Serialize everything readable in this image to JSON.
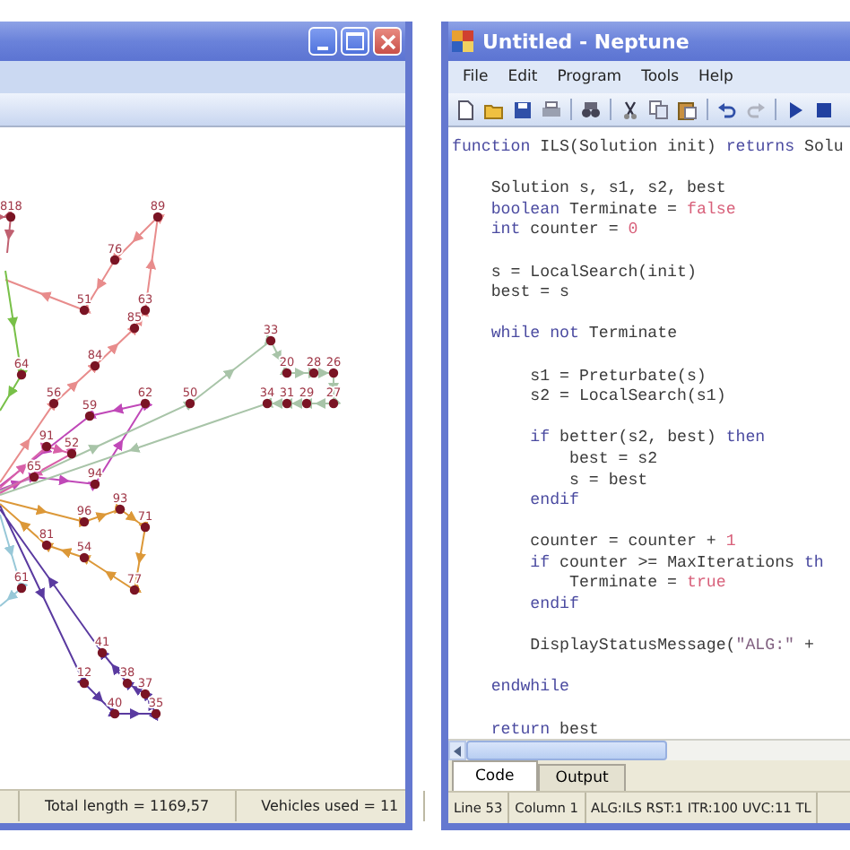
{
  "graph_window": {
    "routes": [
      {
        "color": "#e88c8c",
        "stops": [
          {
            "label": "56"
          },
          {
            "label": "84"
          },
          {
            "label": "85"
          },
          {
            "label": "63"
          },
          {
            "label": "89"
          },
          {
            "label": "76"
          },
          {
            "label": "51"
          }
        ]
      },
      {
        "color": "#78c048",
        "stops": [
          {
            "label": "64"
          }
        ]
      },
      {
        "color": "#c048b8",
        "stops": [
          {
            "label": "65"
          },
          {
            "label": "94"
          },
          {
            "label": "62"
          },
          {
            "label": "59"
          }
        ]
      },
      {
        "color": "#a8c4a8",
        "stops": [
          {
            "label": "50"
          },
          {
            "label": "33"
          },
          {
            "label": "20"
          },
          {
            "label": "28"
          },
          {
            "label": "26"
          }
        ]
      },
      {
        "color": "#dc9838",
        "stops": [
          {
            "label": "96"
          },
          {
            "label": "93"
          },
          {
            "label": "71"
          },
          {
            "label": "77"
          },
          {
            "label": "54"
          },
          {
            "label": "81"
          }
        ]
      },
      {
        "color": "#5a3aa0",
        "stops": [
          {
            "label": "12"
          },
          {
            "label": "40"
          },
          {
            "label": "35"
          },
          {
            "label": "37"
          },
          {
            "label": "38"
          },
          {
            "label": "41"
          }
        ]
      },
      {
        "color": "#98c8d8",
        "stops": [
          {
            "label": "61"
          }
        ]
      },
      {
        "color": "#d860a8",
        "stops": [
          {
            "label": "91"
          },
          {
            "label": "52"
          }
        ]
      },
      {
        "color": "#c06070",
        "stops": [
          {
            "label": "818"
          }
        ]
      },
      {
        "color": "#a8c4a8",
        "reversed": true,
        "stops": [
          {
            "label": "34"
          },
          {
            "label": "31"
          },
          {
            "label": "29"
          },
          {
            "label": "27"
          }
        ]
      }
    ],
    "status_bar": [
      "Total length = 1169,57",
      "Vehicles used = 11"
    ]
  },
  "editor_window": {
    "title": "Untitled - Neptune",
    "menu": [
      "File",
      "Edit",
      "Program",
      "Tools",
      "Help"
    ],
    "code_lines": [
      {
        "kind": "code",
        "tokens": [
          {
            "kind": "kw",
            "text": "function"
          },
          {
            "kind": "text",
            "text": " ILS(Solution init) "
          },
          {
            "kind": "kw",
            "text": "returns"
          },
          {
            "kind": "text",
            "text": " Solu"
          }
        ]
      },
      {
        "kind": "blank"
      },
      {
        "kind": "code",
        "tokens": [
          {
            "kind": "text",
            "text": "    Solution s, s1, s2, best"
          }
        ]
      },
      {
        "kind": "code",
        "tokens": [
          {
            "kind": "kw",
            "text": "    boolean"
          },
          {
            "kind": "text",
            "text": " Terminate = "
          },
          {
            "kind": "lit",
            "text": "false"
          }
        ]
      },
      {
        "kind": "code",
        "tokens": [
          {
            "kind": "kw",
            "text": "    int"
          },
          {
            "kind": "text",
            "text": " counter = "
          },
          {
            "kind": "lit",
            "text": "0"
          }
        ]
      },
      {
        "kind": "blank"
      },
      {
        "kind": "code",
        "tokens": [
          {
            "kind": "text",
            "text": "    s = LocalSearch(init)"
          }
        ]
      },
      {
        "kind": "code",
        "tokens": [
          {
            "kind": "text",
            "text": "    best = s"
          }
        ]
      },
      {
        "kind": "blank"
      },
      {
        "kind": "code",
        "tokens": [
          {
            "kind": "kw",
            "text": "    while not"
          },
          {
            "kind": "text",
            "text": " Terminate"
          }
        ]
      },
      {
        "kind": "blank"
      },
      {
        "kind": "code",
        "tokens": [
          {
            "kind": "text",
            "text": "        s1 = Preturbate(s)"
          }
        ]
      },
      {
        "kind": "code",
        "tokens": [
          {
            "kind": "text",
            "text": "        s2 = LocalSearch(s1)"
          }
        ]
      },
      {
        "kind": "blank"
      },
      {
        "kind": "code",
        "tokens": [
          {
            "kind": "kw",
            "text": "        if"
          },
          {
            "kind": "text",
            "text": " better(s2, best) "
          },
          {
            "kind": "kw",
            "text": "then"
          }
        ]
      },
      {
        "kind": "code",
        "tokens": [
          {
            "kind": "text",
            "text": "            best = s2"
          }
        ]
      },
      {
        "kind": "code",
        "tokens": [
          {
            "kind": "text",
            "text": "            s = best"
          }
        ]
      },
      {
        "kind": "code",
        "tokens": [
          {
            "kind": "kw",
            "text": "        endif"
          }
        ]
      },
      {
        "kind": "blank"
      },
      {
        "kind": "code",
        "tokens": [
          {
            "kind": "text",
            "text": "        counter = counter + "
          },
          {
            "kind": "lit",
            "text": "1"
          }
        ]
      },
      {
        "kind": "code",
        "tokens": [
          {
            "kind": "kw",
            "text": "        if"
          },
          {
            "kind": "text",
            "text": " counter >= MaxIterations "
          },
          {
            "kind": "kw",
            "text": "th"
          }
        ]
      },
      {
        "kind": "code",
        "tokens": [
          {
            "kind": "text",
            "text": "            Terminate = "
          },
          {
            "kind": "lit",
            "text": "true"
          }
        ]
      },
      {
        "kind": "code",
        "tokens": [
          {
            "kind": "kw",
            "text": "        endif"
          }
        ]
      },
      {
        "kind": "blank"
      },
      {
        "kind": "code",
        "tokens": [
          {
            "kind": "text",
            "text": "        DisplayStatusMessage("
          },
          {
            "kind": "str",
            "text": "\"ALG:\""
          },
          {
            "kind": "text",
            "text": " +"
          }
        ]
      },
      {
        "kind": "blank"
      },
      {
        "kind": "code",
        "tokens": [
          {
            "kind": "kw",
            "text": "    endwhile"
          }
        ]
      },
      {
        "kind": "blank"
      },
      {
        "kind": "code",
        "tokens": [
          {
            "kind": "kw",
            "text": "    return"
          },
          {
            "kind": "text",
            "text": " best"
          }
        ]
      }
    ],
    "tabs": [
      {
        "label": "Code",
        "selected": true
      },
      {
        "label": "Output",
        "selected": false
      }
    ],
    "status_bar": [
      "Line 53",
      "Column 1",
      "ALG:ILS RST:1 ITR:100 UVC:11 TL"
    ]
  }
}
